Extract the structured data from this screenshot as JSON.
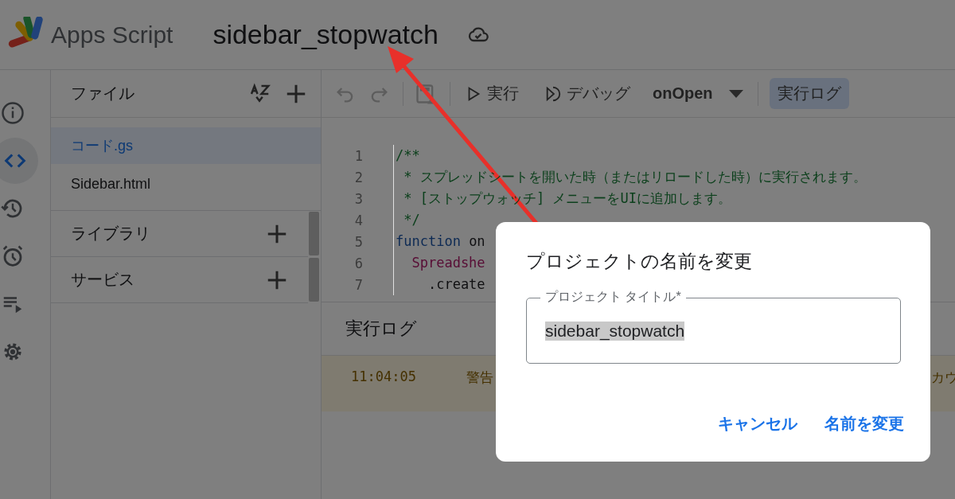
{
  "header": {
    "app_name": "Apps Script",
    "project_title": "sidebar_stopwatch"
  },
  "rail": [
    {
      "kind": "info",
      "selected": false
    },
    {
      "kind": "code",
      "selected": true
    },
    {
      "kind": "history",
      "selected": false
    },
    {
      "kind": "trigger",
      "selected": false
    },
    {
      "kind": "executions",
      "selected": false
    },
    {
      "kind": "settings",
      "selected": false
    }
  ],
  "file_panel": {
    "title": "ファイル",
    "files": [
      {
        "name": "コード.gs",
        "selected": true
      },
      {
        "name": "Sidebar.html",
        "selected": false
      }
    ],
    "sections": [
      {
        "label": "ライブラリ"
      },
      {
        "label": "サービス"
      }
    ]
  },
  "toolbar": {
    "run": "実行",
    "debug": "デバッグ",
    "function": "onOpen",
    "log_button": {
      "label": "実行ログ",
      "selected": true
    }
  },
  "editor": {
    "lines": [
      {
        "number": "1",
        "segments": [
          {
            "text": "/**",
            "kind": "comment"
          }
        ]
      },
      {
        "number": "2",
        "segments": [
          {
            "text": " * スプレッドシートを開いた時（またはリロードした時）に実行されます。",
            "kind": "comment"
          }
        ]
      },
      {
        "number": "3",
        "segments": [
          {
            "text": " * [ストップウォッチ] メニューをUIに追加します。",
            "kind": "comment"
          }
        ]
      },
      {
        "number": "4",
        "segments": [
          {
            "text": " */",
            "kind": "comment"
          }
        ]
      },
      {
        "number": "5",
        "segments": [
          {
            "text": "function",
            "kind": "keyword"
          },
          {
            "text": " on",
            "kind": "plain"
          }
        ]
      },
      {
        "number": "6",
        "segments": [
          {
            "text": "  Spreadshe",
            "kind": "class"
          }
        ]
      },
      {
        "number": "7",
        "segments": [
          {
            "text": "    .create",
            "kind": "plain"
          }
        ]
      }
    ]
  },
  "log": {
    "title": "実行ログ",
    "rows": [
      {
        "time": "11:04:05",
        "level": "警告",
        "message": "カウ"
      }
    ]
  },
  "dialog": {
    "title": "プロジェクトの名前を変更",
    "field": {
      "label": "プロジェクト タイトル*",
      "value": "sidebar_stopwatch",
      "text_selected": true
    },
    "buttons": [
      "キャンセル",
      "名前を変更"
    ]
  }
}
